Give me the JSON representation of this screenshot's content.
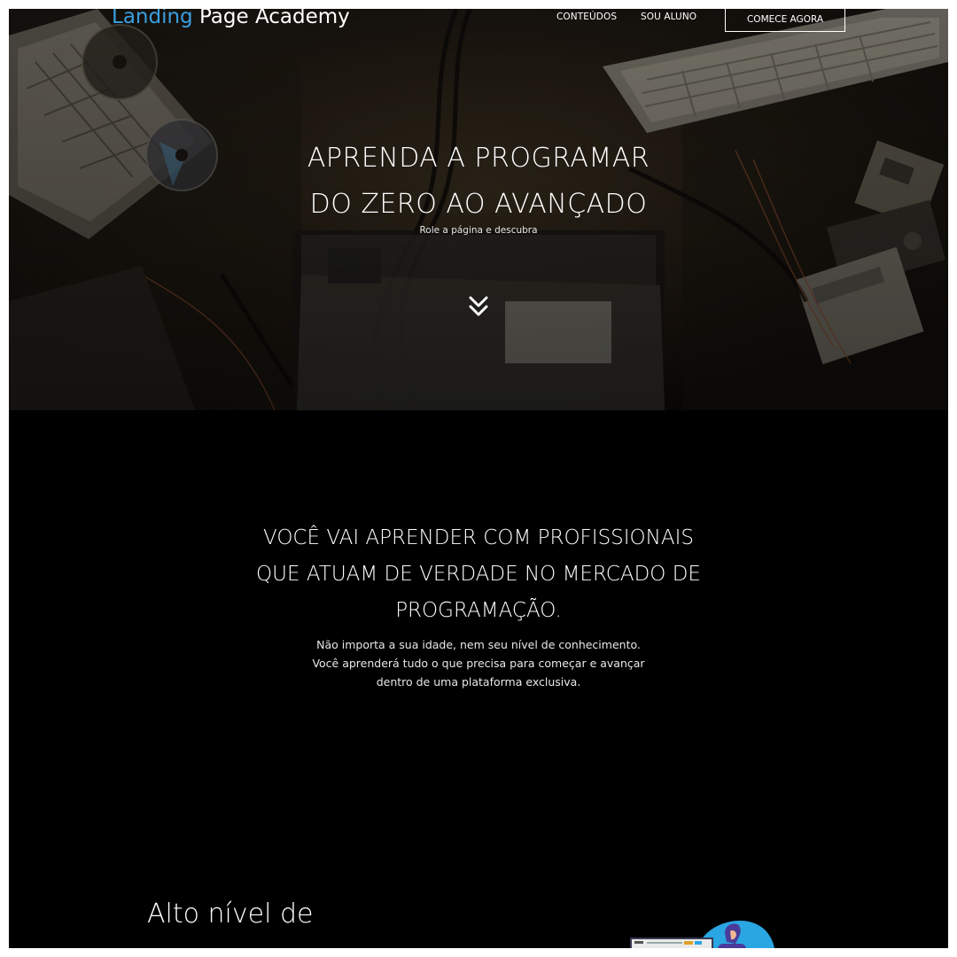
{
  "nav": {
    "logo_part1": "Landing",
    "logo_part2": " Page Academy",
    "link_contents": "CONTEÚDOS",
    "link_student": "SOU ALUNO",
    "cta_label": "COMECE AGORA"
  },
  "hero": {
    "title_line1": "APRENDA A PROGRAMAR",
    "title_line2": "DO ZERO AO AVANÇADO",
    "subtitle": "Role a página e descubra"
  },
  "about": {
    "title_line1": "VOCÊ VAI APRENDER COM PROFISSIONAIS",
    "title_line2": "QUE ATUAM DE VERDADE NO MERCADO DE",
    "title_line3": "PROGRAMAÇÃO.",
    "text_line1": "Não importa a sua idade, nem seu nível de conhecimento.",
    "text_line2": "Você aprenderá tudo o que precisa para começar e avançar",
    "text_line3": "dentro de uma plataforma exclusiva."
  },
  "feature": {
    "title_line1": "Alto nível de"
  },
  "colors": {
    "accent": "#3a9fe0",
    "background": "#000000",
    "text": "#ffffff"
  }
}
